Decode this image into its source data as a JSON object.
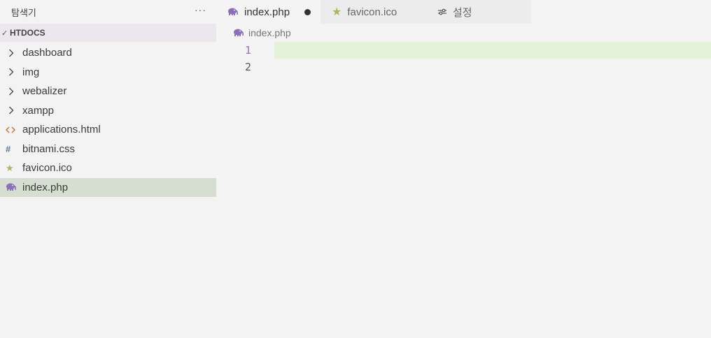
{
  "sidebar": {
    "title": "탐색기",
    "more": "···",
    "folder": {
      "name": "HTDOCS",
      "chevron": "✓"
    },
    "items": [
      {
        "label": "dashboard",
        "icon": "chevron-right-icon",
        "type": "folder"
      },
      {
        "label": "img",
        "icon": "chevron-right-icon",
        "type": "folder"
      },
      {
        "label": "webalizer",
        "icon": "chevron-right-icon",
        "type": "folder"
      },
      {
        "label": "xampp",
        "icon": "chevron-right-icon",
        "type": "folder"
      },
      {
        "label": "applications.html",
        "icon": "html-file-icon",
        "type": "file"
      },
      {
        "label": "bitnami.css",
        "icon": "css-file-icon",
        "type": "file"
      },
      {
        "label": "favicon.ico",
        "icon": "star-icon",
        "type": "file"
      },
      {
        "label": "index.php",
        "icon": "php-elephant-icon",
        "type": "file",
        "selected": true
      }
    ]
  },
  "tabs": [
    {
      "label": "index.php",
      "icon": "php-elephant-icon",
      "active": true,
      "dirty": true
    },
    {
      "label": "favicon.ico",
      "icon": "star-icon",
      "active": false
    },
    {
      "label": "설정",
      "icon": "settings-sliders-icon",
      "active": false
    }
  ],
  "breadcrumb": {
    "label": "index.php",
    "icon": "php-elephant-icon"
  },
  "editor": {
    "lines": [
      {
        "number": "1",
        "text": "",
        "current": true
      },
      {
        "number": "2",
        "text": ""
      }
    ]
  },
  "colors": {
    "php": "#8b6fb8",
    "star": "#b6b062",
    "html": "#c3703a",
    "css": "#5c7891",
    "selection": "#d6ddd1",
    "current_line": "#e4f2d9"
  }
}
